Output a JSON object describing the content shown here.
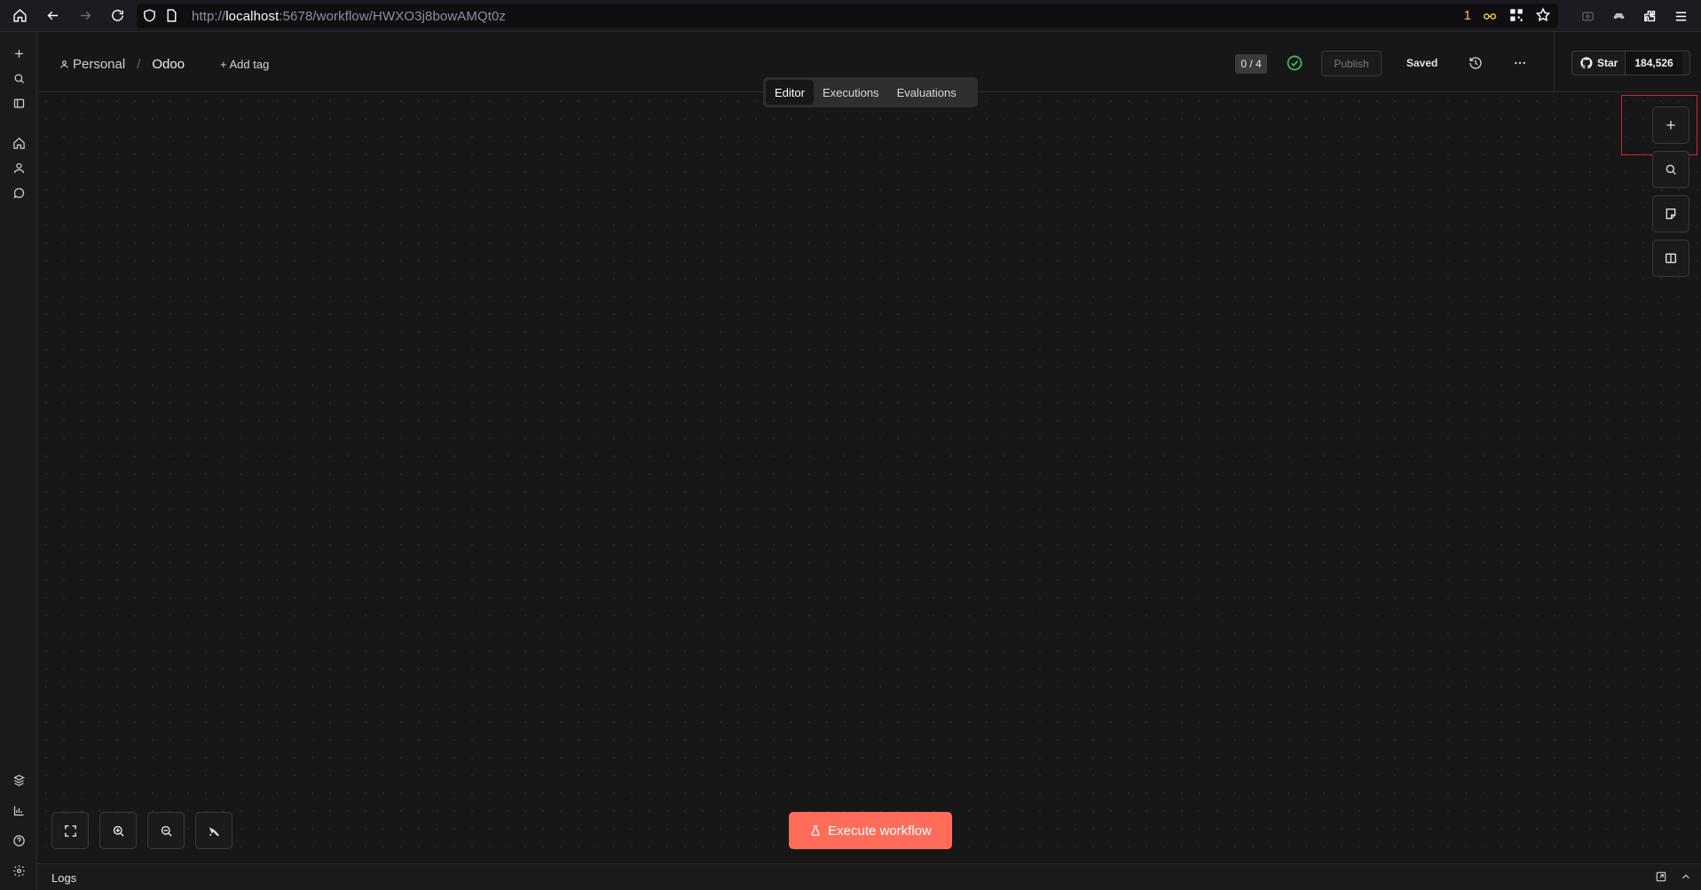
{
  "browser": {
    "url_prefix": "http://",
    "url_host": "localhost",
    "url_rest": ":5678/workflow/HWXO3j8bowAMQt0z",
    "extension_badge": "1"
  },
  "header": {
    "project": "Personal",
    "workflow_name": "Odoo",
    "add_tag": "+ Add tag",
    "counter": "0 / 4",
    "publish": "Publish",
    "saved": "Saved"
  },
  "tabs": [
    {
      "label": "Editor",
      "active": true
    },
    {
      "label": "Executions",
      "active": false
    },
    {
      "label": "Evaluations",
      "active": false
    }
  ],
  "github": {
    "star_label": "Star",
    "star_count": "184,526"
  },
  "execute_button": "Execute workflow",
  "logs": {
    "label": "Logs"
  },
  "colors": {
    "accent": "#ff6d5a",
    "success": "#3ec07a",
    "highlight": "#d0262f"
  }
}
